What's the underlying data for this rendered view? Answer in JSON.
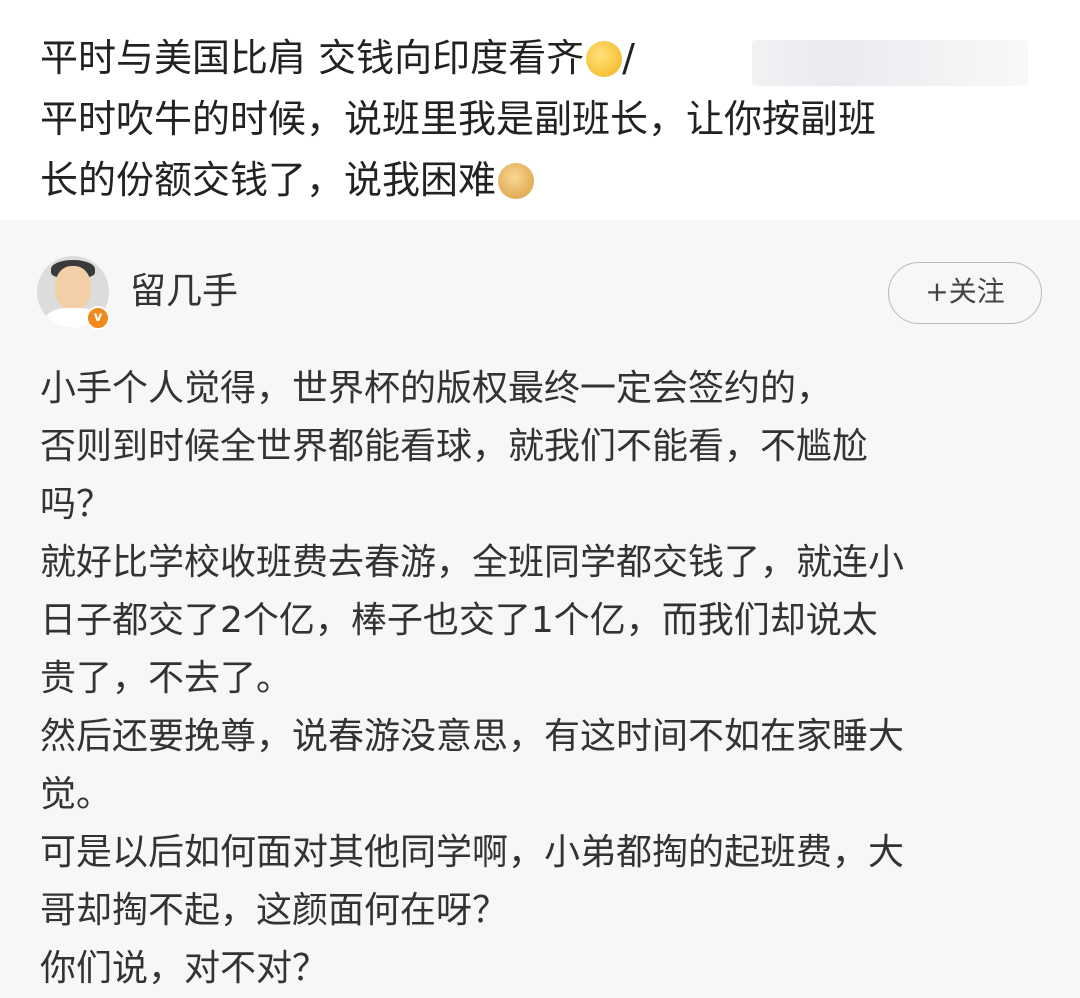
{
  "quote": {
    "lines": [
      "平时与美国比肩 交钱向印度看齐",
      "平时吹牛的时候，说班里我是副班长，让你按副班",
      "长的份额交钱了，说我困难"
    ],
    "line1_suffix": "/"
  },
  "icons": {
    "emoji1": "shushing-face-emoji",
    "emoji2": "doge-emoji",
    "badge": "verified-badge-icon"
  },
  "author": {
    "name": "留几手",
    "badge_text": "v"
  },
  "follow_button": {
    "label": "+关注"
  },
  "post": {
    "lines": [
      "小手个人觉得，世界杯的版权最终一定会签约的，",
      "否则到时候全世界都能看球，就我们不能看，不尴尬",
      "吗？",
      "就好比学校收班费去春游，全班同学都交钱了，就连小",
      "日子都交了2个亿，棒子也交了1个亿，而我们却说太",
      "贵了，不去了。",
      "然后还要挽尊，说春游没意思，有这时间不如在家睡大",
      "觉。",
      "可是以后如何面对其他同学啊，小弟都掏的起班费，大",
      "哥却掏不起，这颜面何在呀？",
      "你们说，对不对？"
    ]
  },
  "colors": {
    "badge": "#f08a1c",
    "card_bg": "#f7f7f7"
  }
}
